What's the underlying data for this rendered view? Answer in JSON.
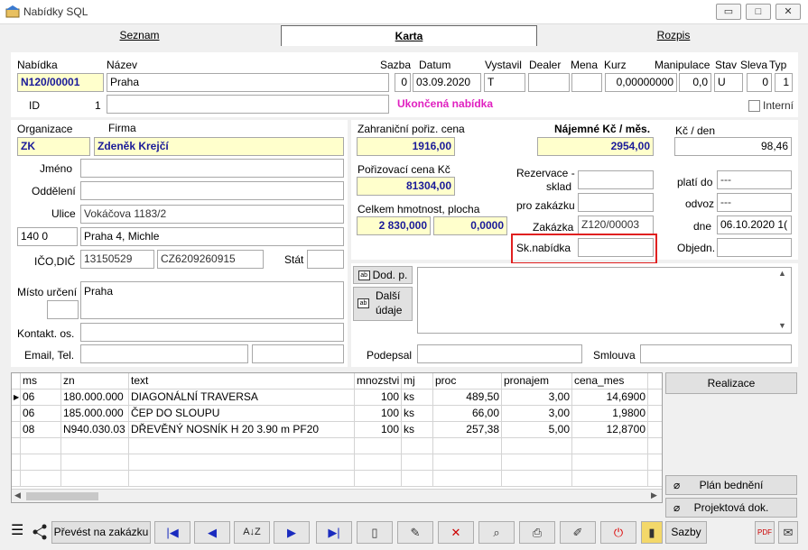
{
  "window": {
    "title": "Nabídky SQL"
  },
  "tabs": [
    {
      "label": "Seznam"
    },
    {
      "label": "Karta"
    },
    {
      "label": "Rozpis"
    }
  ],
  "header": {
    "labels": {
      "nabidka": "Nabídka",
      "nazev": "Název",
      "sazba": "Sazba",
      "datum": "Datum",
      "vystavil": "Vystavil",
      "dealer": "Dealer",
      "mena": "Mena",
      "kurz": "Kurz",
      "manipulace": "Manipulace",
      "stav": "Stav",
      "sleva": "Sleva",
      "typ": "Typ",
      "id": "ID",
      "interni": "Interní"
    },
    "nabidka": "N120/00001",
    "nazev": "Praha",
    "sazba": "0",
    "datum": "03.09.2020",
    "vystavil": "T",
    "dealer": "",
    "mena": "",
    "kurz": "0,00000000",
    "manipulace": "0,0",
    "stav": "U",
    "sleva": "0",
    "typ": "1",
    "id_value": "1",
    "status": "Ukončená nabídka"
  },
  "org": {
    "labels": {
      "organizace": "Organizace",
      "firma": "Firma",
      "jmeno": "Jméno",
      "oddeleni": "Oddělení",
      "ulice": "Ulice",
      "ico_dic": "IČO,DIČ",
      "stat": "Stát",
      "misto": "Místo určení",
      "kontakt": "Kontakt. os.",
      "email": "Email, Tel."
    },
    "organizace": "ZK",
    "firma": "Zdeněk Krejčí",
    "jmeno": "",
    "oddeleni": "",
    "ulice": "Vokáčova 1183/2",
    "psc": "140  0",
    "mesto": "Praha 4, Michle",
    "ico": "13150529",
    "dic": "CZ6209260915",
    "stat": "",
    "misto": "Praha",
    "kontakt": "",
    "email": "",
    "tel": ""
  },
  "costs": {
    "labels": {
      "zahr": "Zahraniční pořiz. cena",
      "najem": "Nájemné Kč / měs.",
      "kc_den": "Kč / den",
      "poriz": "Pořizovací cena Kč",
      "hmotnost": "Celkem hmotnost, plocha",
      "rezervace": "Rezervace -",
      "sklad": "sklad",
      "pro_zakazku": "pro zakázku",
      "zakazka": "Zakázka",
      "sk_nabidka": "Sk.nabídka",
      "plati_do": "platí do",
      "odvoz": "odvoz",
      "dne": "dne",
      "objedn": "Objedn."
    },
    "zahr": "1916,00",
    "najem": "2954,00",
    "kc_den": "98,46",
    "poriz": "81304,00",
    "hmotnost": "2 830,000",
    "plocha": "0,0000",
    "sklad": "",
    "pro_zakazku": "",
    "zakazka": "Z120/00003",
    "sk_nabidka": "",
    "plati_do": "---",
    "odvoz": "---",
    "dne": "06.10.2020 1(",
    "objedn": ""
  },
  "notes": {
    "dod_p": "Dod. p.",
    "dalsi": "Další",
    "udaje": "údaje",
    "podepsal_label": "Podepsal",
    "smlouva_label": "Smlouva",
    "podepsal": "",
    "smlouva": ""
  },
  "grid": {
    "columns": [
      "ms",
      "zn",
      "text",
      "mnozstvi",
      "mj",
      "proc",
      "pronajem",
      "cena_mes"
    ],
    "rows": [
      {
        "ms": "06",
        "zn": "180.000.000",
        "text": "DIAGONÁLNÍ TRAVERSA",
        "mnozstvi": "100",
        "mj": "ks",
        "proc": "489,50",
        "pronajem": "3,00",
        "cena_mes": "14,6900"
      },
      {
        "ms": "06",
        "zn": "185.000.000",
        "text": "ČEP DO SLOUPU",
        "mnozstvi": "100",
        "mj": "ks",
        "proc": "66,00",
        "pronajem": "3,00",
        "cena_mes": "1,9800"
      },
      {
        "ms": "08",
        "zn": "N940.030.03",
        "text": "DŘEVĚNÝ NOSNÍK H 20 3.90 m PF20",
        "mnozstvi": "100",
        "mj": "ks",
        "proc": "257,38",
        "pronajem": "5,00",
        "cena_mes": "12,8700"
      }
    ]
  },
  "side_buttons": {
    "realizace": "Realizace",
    "plan": "Plán bednění",
    "projekt": "Projektová dok."
  },
  "toolbar": {
    "prevest": "Převést na zakázku",
    "sazby": "Sazby"
  }
}
